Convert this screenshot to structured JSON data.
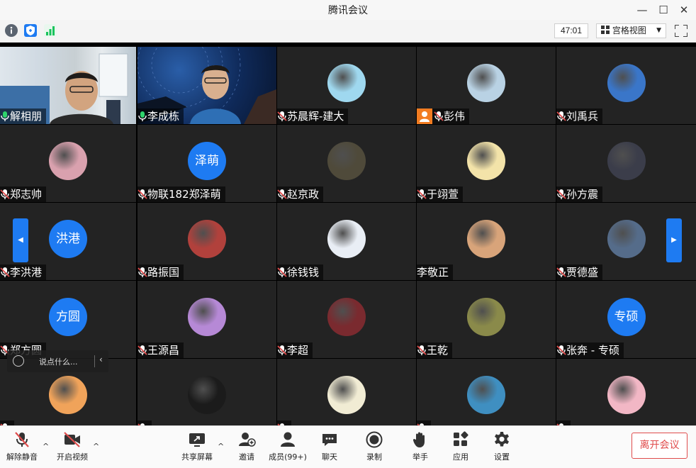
{
  "window": {
    "title": "腾讯会议",
    "minimize": "—",
    "maximize": "☐",
    "close": "✕"
  },
  "infobar": {
    "timer": "47:01",
    "view_label": "宫格视图",
    "colors": {
      "info": "#5b6470",
      "shield": "#1e7bf2",
      "signal": "#19c35c"
    }
  },
  "participants": [
    {
      "name": "解相朋",
      "type": "video",
      "mic": "on"
    },
    {
      "name": "李成栋",
      "type": "video",
      "mic": "on",
      "active": true
    },
    {
      "name": "苏晨辉-建大",
      "type": "photo",
      "mic": "off",
      "color": "#9fd8ef"
    },
    {
      "name": "彭伟",
      "type": "photo",
      "mic": "off",
      "host": true,
      "color": "#b9d2e4"
    },
    {
      "name": "刘禹兵",
      "type": "photo",
      "mic": "off",
      "color": "#3a76c9"
    },
    {
      "name": "郑志帅",
      "type": "photo",
      "mic": "off",
      "color": "#d9a1ae"
    },
    {
      "name": "物联182郑泽萌",
      "type": "text",
      "mic": "off",
      "avatar_text": "泽萌"
    },
    {
      "name": "赵京政",
      "type": "photo",
      "mic": "off",
      "color": "#4f4a3a"
    },
    {
      "name": "于翊萱",
      "type": "photo",
      "mic": "off",
      "color": "#f3e3a9"
    },
    {
      "name": "孙方震",
      "type": "photo",
      "mic": "off",
      "color": "#3b3d4a"
    },
    {
      "name": "李洪港",
      "type": "text",
      "mic": "off",
      "avatar_text": "洪港"
    },
    {
      "name": "路振国",
      "type": "photo",
      "mic": "off",
      "color": "#b1413c"
    },
    {
      "name": "徐钱钱",
      "type": "photo",
      "mic": "off",
      "color": "#e9eef5"
    },
    {
      "name": "李敬正",
      "type": "photo",
      "mic": "none",
      "color": "#d8a47a"
    },
    {
      "name": "贾德盛",
      "type": "photo",
      "mic": "off",
      "color": "#556c8a"
    },
    {
      "name": "郑方圆",
      "type": "text",
      "mic": "off",
      "avatar_text": "方圆"
    },
    {
      "name": "王源昌",
      "type": "photo",
      "mic": "off",
      "color": "#b689d6"
    },
    {
      "name": "李超",
      "type": "photo",
      "mic": "off",
      "color": "#7a2a2f"
    },
    {
      "name": "王乾",
      "type": "photo",
      "mic": "off",
      "color": "#8a8a4a"
    },
    {
      "name": "张奔 - 专硕",
      "type": "text",
      "mic": "off",
      "avatar_text": "专硕"
    },
    {
      "name": "",
      "type": "photo",
      "mic": "off",
      "color": "#f0a35a"
    },
    {
      "name": "",
      "type": "photo",
      "mic": "off",
      "color": "#1b1b1b"
    },
    {
      "name": "",
      "type": "photo",
      "mic": "off",
      "color": "#f1ecd4"
    },
    {
      "name": "",
      "type": "photo",
      "mic": "off",
      "color": "#3f8fc1"
    },
    {
      "name": "",
      "type": "photo",
      "mic": "off",
      "color": "#f2b7c5"
    }
  ],
  "chat": {
    "placeholder": "说点什么...",
    "back": "‹"
  },
  "nav": {
    "prev": "◀",
    "next": "▶"
  },
  "toolbar": {
    "unmute": "解除静音",
    "start_video": "开启视频",
    "share_screen": "共享屏幕",
    "invite": "邀请",
    "members": "成员(99+)",
    "chat": "聊天",
    "record": "录制",
    "raise_hand": "举手",
    "apps": "应用",
    "settings": "设置",
    "leave": "离开会议",
    "caret": "^"
  }
}
